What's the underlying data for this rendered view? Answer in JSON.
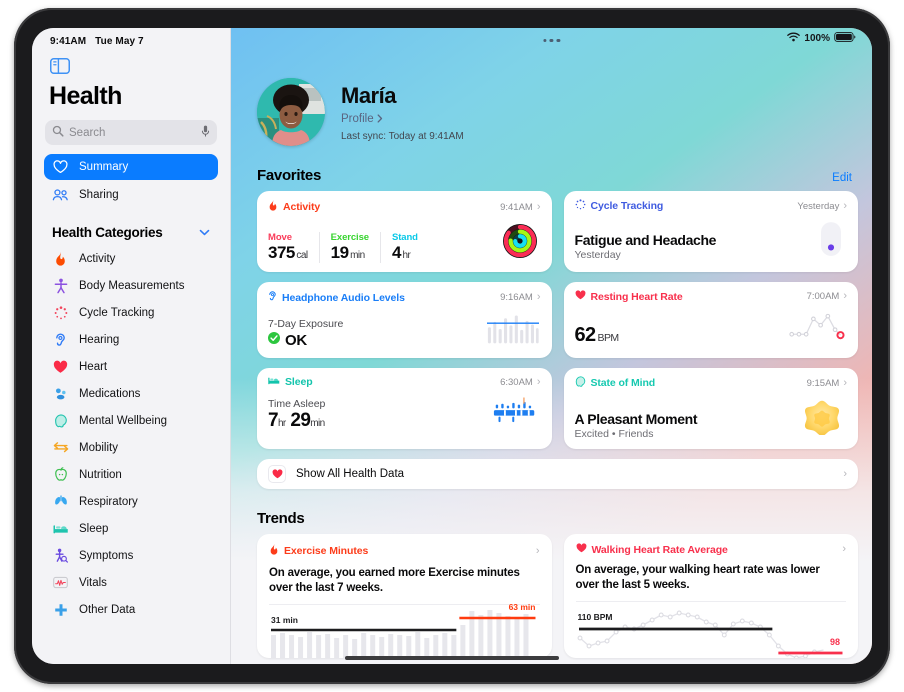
{
  "status_bar": {
    "time": "9:41AM",
    "date": "Tue May 7",
    "wifi_icon": "wifi-icon",
    "battery_percent": "100%",
    "battery_icon": "battery-full-icon"
  },
  "sidebar": {
    "toggle_icon": "sidebar-toggle-icon",
    "app_title": "Health",
    "search": {
      "placeholder": "Search",
      "icon": "search-icon",
      "mic_icon": "microphone-icon"
    },
    "primary_items": [
      {
        "label": "Summary",
        "icon": "heart-outline-icon",
        "selected": true
      },
      {
        "label": "Sharing",
        "icon": "two-people-icon",
        "selected": false
      }
    ],
    "categories_header": {
      "label": "Health Categories",
      "chevron_icon": "chevron-down-icon"
    },
    "categories": [
      {
        "label": "Activity",
        "icon": "flame-icon",
        "color": "#fc4c02"
      },
      {
        "label": "Body Measurements",
        "icon": "body-figure-icon",
        "color": "#8c52e0"
      },
      {
        "label": "Cycle Tracking",
        "icon": "cycle-dots-icon",
        "color": "#f2445c"
      },
      {
        "label": "Hearing",
        "icon": "ear-icon",
        "color": "#2f7bf6"
      },
      {
        "label": "Heart",
        "icon": "heart-filled-icon",
        "color": "#fa २b47"
      },
      {
        "label": "Medications",
        "icon": "pills-icon",
        "color": "#3aa0e8"
      },
      {
        "label": "Mental Wellbeing",
        "icon": "head-profile-icon",
        "color": "#22c3ae"
      },
      {
        "label": "Mobility",
        "icon": "arrows-lr-icon",
        "color": "#f5a623"
      },
      {
        "label": "Nutrition",
        "icon": "apple-icon",
        "color": "#3fbf52"
      },
      {
        "label": "Respiratory",
        "icon": "lungs-icon",
        "color": "#38a8f0"
      },
      {
        "label": "Sleep",
        "icon": "bed-icon",
        "color": "#1fc4ae"
      },
      {
        "label": "Symptoms",
        "icon": "person-magnifier-icon",
        "color": "#6a4ae0"
      },
      {
        "label": "Vitals",
        "icon": "waveform-box-icon",
        "color": "#f2445c"
      },
      {
        "label": "Other Data",
        "icon": "plus-cross-icon",
        "color": "#3aa0e8"
      }
    ]
  },
  "multitask_handle_icon": "multitask-dots-icon",
  "profile": {
    "avatar_icon": "user-avatar",
    "name": "María",
    "profile_link": "Profile",
    "profile_chevron_icon": "chevron-right-icon",
    "last_sync": "Last sync: Today at 9:41AM"
  },
  "favorites": {
    "title": "Favorites",
    "edit_label": "Edit",
    "cards": [
      {
        "id": "activity",
        "tag": "Activity",
        "tag_color": "#fc3c1a",
        "icon": "flame-icon",
        "time": "9:41AM",
        "chevron_icon": "chevron-right-icon",
        "metrics": [
          {
            "label": "Move",
            "label_color": "#fa3c5a",
            "value": "375",
            "unit": "cal"
          },
          {
            "label": "Exercise",
            "label_color": "#38d430",
            "value": "19",
            "unit": "min"
          },
          {
            "label": "Stand",
            "label_color": "#0ac9e8",
            "value": "4",
            "unit": "hr"
          }
        ],
        "visual": "activity-rings"
      },
      {
        "id": "cycle-tracking",
        "tag": "Cycle Tracking",
        "tag_color": "#3f5be0",
        "icon": "cycle-dots-icon",
        "time": "Yesterday",
        "chevron_icon": "chevron-right-icon",
        "headline": "Fatigue and Headache",
        "subline": "Yesterday",
        "visual": "cycle-pill"
      },
      {
        "id": "headphone-audio-levels",
        "tag": "Headphone Audio Levels",
        "tag_color": "#1a7ef7",
        "icon": "ear-icon",
        "time": "9:16AM",
        "chevron_icon": "chevron-right-icon",
        "label": "7-Day Exposure",
        "status": "OK",
        "status_icon": "check-circle-icon",
        "status_color": "#2cc63f",
        "visual": "audio-bars"
      },
      {
        "id": "resting-heart-rate",
        "tag": "Resting Heart Rate",
        "tag_color": "#f8304c",
        "icon": "heart-filled-icon",
        "time": "7:00AM",
        "chevron_icon": "chevron-right-icon",
        "value": "62",
        "unit": "BPM",
        "visual": "hr-sparkline"
      },
      {
        "id": "sleep",
        "tag": "Sleep",
        "tag_color": "#13c4ac",
        "icon": "bed-icon",
        "time": "6:30AM",
        "chevron_icon": "chevron-right-icon",
        "label": "Time Asleep",
        "hours": "7",
        "hours_unit": "hr",
        "minutes": "29",
        "minutes_unit": "min",
        "visual": "sleep-bars"
      },
      {
        "id": "state-of-mind",
        "tag": "State of Mind",
        "tag_color": "#16c9b0",
        "icon": "head-profile-icon",
        "time": "9:15AM",
        "chevron_icon": "chevron-right-icon",
        "headline": "A Pleasant Moment",
        "subline": "Excited • Friends",
        "visual": "mood-star"
      }
    ],
    "show_all": {
      "label": "Show All Health Data",
      "icon": "heart-filled-icon",
      "chevron_icon": "chevron-right-icon"
    }
  },
  "trends": {
    "title": "Trends",
    "cards": [
      {
        "id": "exercise-minutes",
        "tag": "Exercise Minutes",
        "tag_color": "#fc3c1a",
        "icon": "flame-icon",
        "chevron_icon": "chevron-right-icon",
        "description": "On average, you earned more Exercise minutes over the last 7 weeks.",
        "baseline_label": "31 min",
        "highlight_label": "63 min",
        "highlight_color": "#ff3b0f"
      },
      {
        "id": "walking-heart-rate-average",
        "tag": "Walking Heart Rate Average",
        "tag_color": "#f8304c",
        "icon": "heart-filled-icon",
        "chevron_icon": "chevron-right-icon",
        "description": "On average, your walking heart rate was lower over the last 5 weeks.",
        "baseline_label": "110 BPM",
        "highlight_label": "98",
        "highlight_color": "#f8304c"
      }
    ]
  },
  "chart_data": [
    {
      "type": "bar",
      "id": "exercise-minutes-trend",
      "title": "Exercise Minutes",
      "ylabel": "minutes",
      "baseline": 31,
      "baseline_label": "31 min",
      "highlight": 63,
      "highlight_label": "63 min",
      "values": [
        30,
        33,
        31,
        29,
        34,
        30,
        32,
        28,
        31,
        27,
        33,
        30,
        29,
        32,
        31,
        30,
        34,
        28,
        31,
        33,
        30,
        44,
        68,
        62,
        70,
        66,
        61,
        58,
        64
      ],
      "highlight_start_index": 21,
      "grid": false,
      "legend": "none"
    },
    {
      "type": "line",
      "id": "walking-heart-rate-trend",
      "title": "Walking Heart Rate Average",
      "ylabel": "BPM",
      "baseline": 110,
      "baseline_label": "110 BPM",
      "highlight": 98,
      "highlight_label": "98",
      "values": [
        106,
        102,
        103,
        104,
        108,
        110,
        109,
        111,
        113,
        115,
        114,
        116,
        115,
        114,
        112,
        111,
        107,
        112,
        113,
        112,
        110,
        107,
        101,
        97,
        95,
        96,
        98,
        99
      ],
      "highlight_start_index": 22,
      "grid": false,
      "legend": "none"
    },
    {
      "type": "bar",
      "id": "headphone-audio-levels-mini",
      "title": "Headphone Audio Levels",
      "values": [
        40,
        70,
        55,
        85,
        60,
        95,
        50,
        75,
        65,
        45
      ],
      "threshold": 75,
      "grid": false,
      "legend": "none"
    },
    {
      "type": "line",
      "id": "resting-heart-rate-mini",
      "title": "Resting Heart Rate",
      "values": [
        58,
        58,
        58,
        58,
        75,
        68,
        78,
        62
      ],
      "grid": false,
      "legend": "none"
    },
    {
      "type": "bar",
      "id": "sleep-stages-mini",
      "title": "Sleep Stages",
      "values": [
        3,
        5,
        4,
        6,
        4,
        5,
        3,
        5
      ],
      "grid": false,
      "legend": "none"
    }
  ]
}
